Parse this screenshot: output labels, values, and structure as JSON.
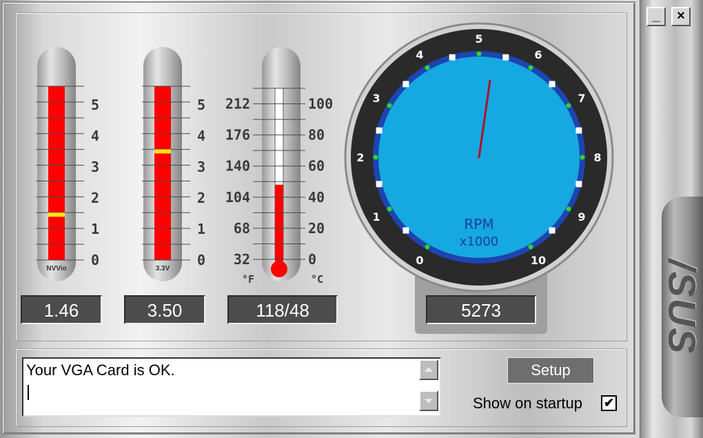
{
  "window": {
    "minimize_symbol": "_",
    "close_symbol": "×"
  },
  "brand": {
    "logo_text": "/SUS"
  },
  "gauges": {
    "voltage1": {
      "tube_label": "NVVio",
      "scale": [
        "5",
        "4",
        "3",
        "2",
        "1",
        "0"
      ],
      "value": 1.46,
      "max": 5.6,
      "readout": "1.46"
    },
    "voltage2": {
      "tube_label": "3.3V",
      "scale": [
        "5",
        "4",
        "3",
        "2",
        "1",
        "0"
      ],
      "value": 3.5,
      "max": 5.6,
      "readout": "3.50"
    },
    "temperature": {
      "fahrenheit_scale": [
        "212",
        "176",
        "140",
        "104",
        "68",
        "32"
      ],
      "celsius_scale": [
        "100",
        "80",
        "60",
        "40",
        "20",
        "0"
      ],
      "unit_f": "°F",
      "unit_c": "°C",
      "celsius_value": 48,
      "celsius_max": 110,
      "readout": "118/48"
    },
    "fan": {
      "dial_numbers": [
        "0",
        "1",
        "2",
        "3",
        "4",
        "5",
        "6",
        "7",
        "8",
        "9",
        "10"
      ],
      "unit_label": "RPM",
      "multiplier_label": "x1000",
      "rpm_thousands": 5.273,
      "readout": "5273"
    }
  },
  "status": {
    "message": "Your VGA Card is OK."
  },
  "controls": {
    "setup_label": "Setup",
    "show_on_startup_label": "Show on startup",
    "show_on_startup_checked": true,
    "check_symbol": "✔"
  },
  "colors": {
    "red": "#ff0000",
    "yellow": "#ffe21a",
    "dial_face": "#16a8e0",
    "dial_ring": "#1d44b0",
    "dial_bezel": "#2a2a2a",
    "needle": "#b0102a"
  }
}
